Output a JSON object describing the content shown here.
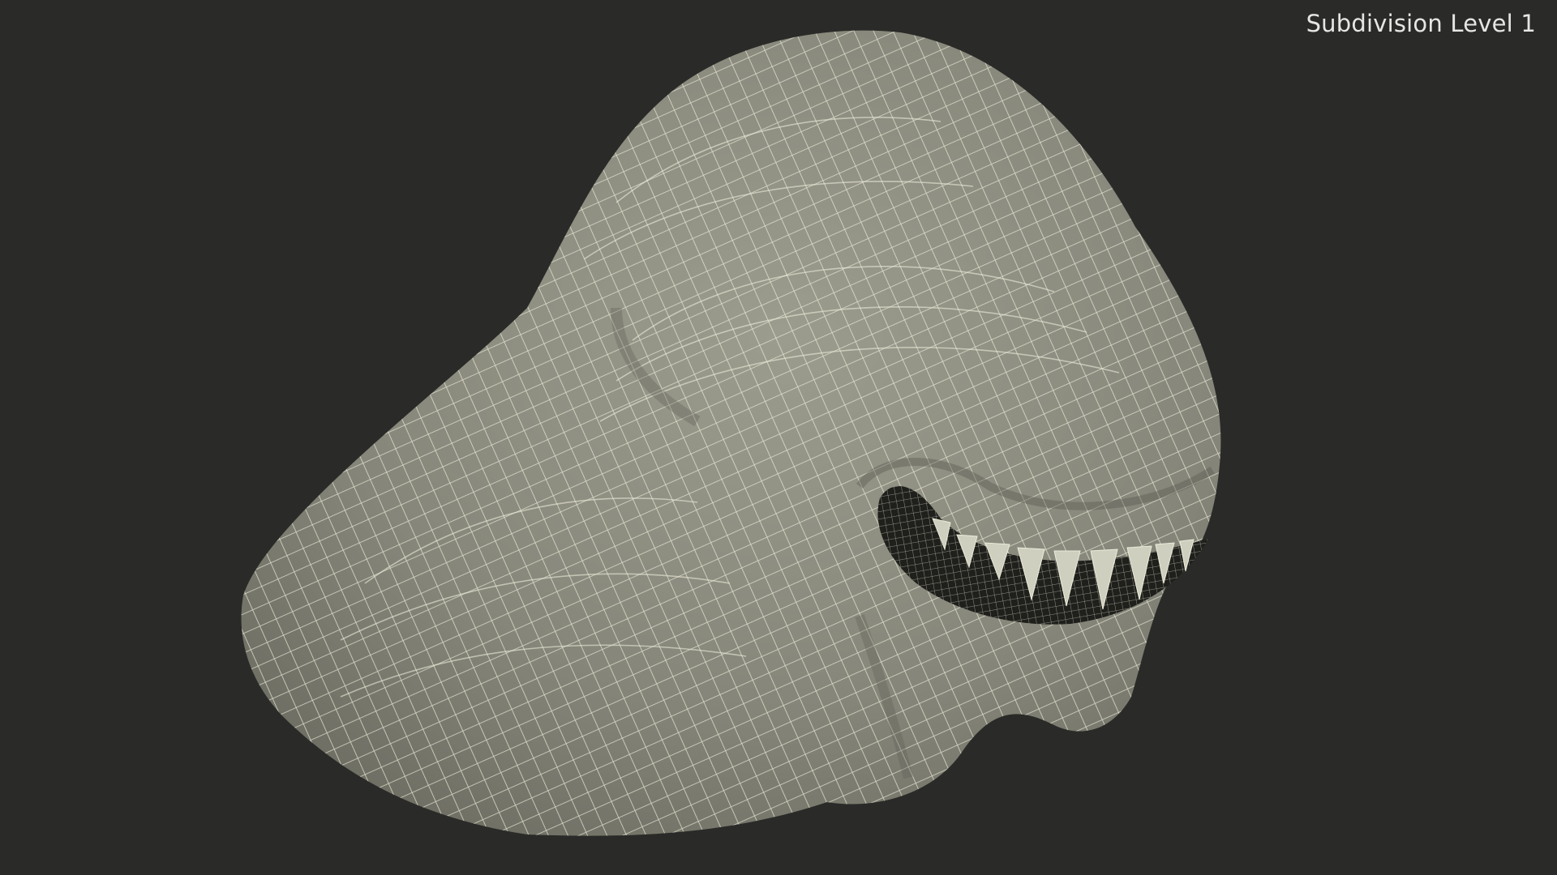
{
  "viewport": {
    "background_color": "#2a2a28",
    "overlay_label": "Subdivision Level 1"
  },
  "model": {
    "subject": "alien creature head",
    "display_mode": "wireframe-on-shaded",
    "surface_color": "#8e8e80",
    "wire_color": "#ecebd9",
    "cavity_color": "#1f1f1c"
  }
}
